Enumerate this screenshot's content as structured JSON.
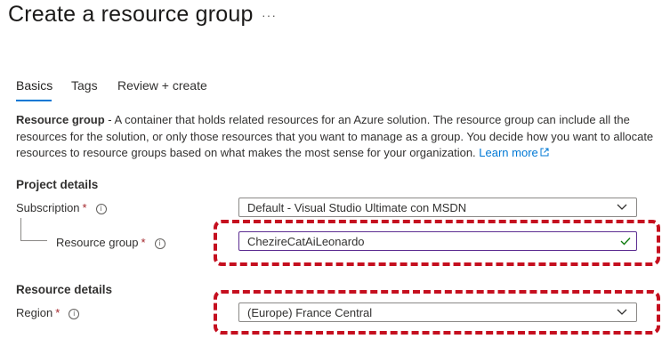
{
  "page": {
    "title": "Create a resource group",
    "more_label": "···"
  },
  "tabs": [
    {
      "label": "Basics",
      "active": true
    },
    {
      "label": "Tags",
      "active": false
    },
    {
      "label": "Review + create",
      "active": false
    }
  ],
  "description": {
    "bold": "Resource group",
    "text": " - A container that holds related resources for an Azure solution. The resource group can include all the resources for the solution, or only those resources that you want to manage as a group. You decide how you want to allocate resources to resource groups based on what makes the most sense for your organization. ",
    "link": "Learn more"
  },
  "project_details": {
    "title": "Project details",
    "subscription": {
      "label": "Subscription",
      "required": "*",
      "info": "i",
      "value": "Default - Visual Studio Ultimate con MSDN"
    },
    "resource_group": {
      "label": "Resource group",
      "required": "*",
      "info": "i",
      "value": "ChezireCatAiLeonardo"
    }
  },
  "resource_details": {
    "title": "Resource details",
    "region": {
      "label": "Region",
      "required": "*",
      "info": "i",
      "value": "(Europe) France Central"
    }
  },
  "colors": {
    "accent": "#0078d4",
    "annotation": "#c50f1f",
    "valid_check": "#107c10",
    "focus_border": "#5c2d91"
  }
}
